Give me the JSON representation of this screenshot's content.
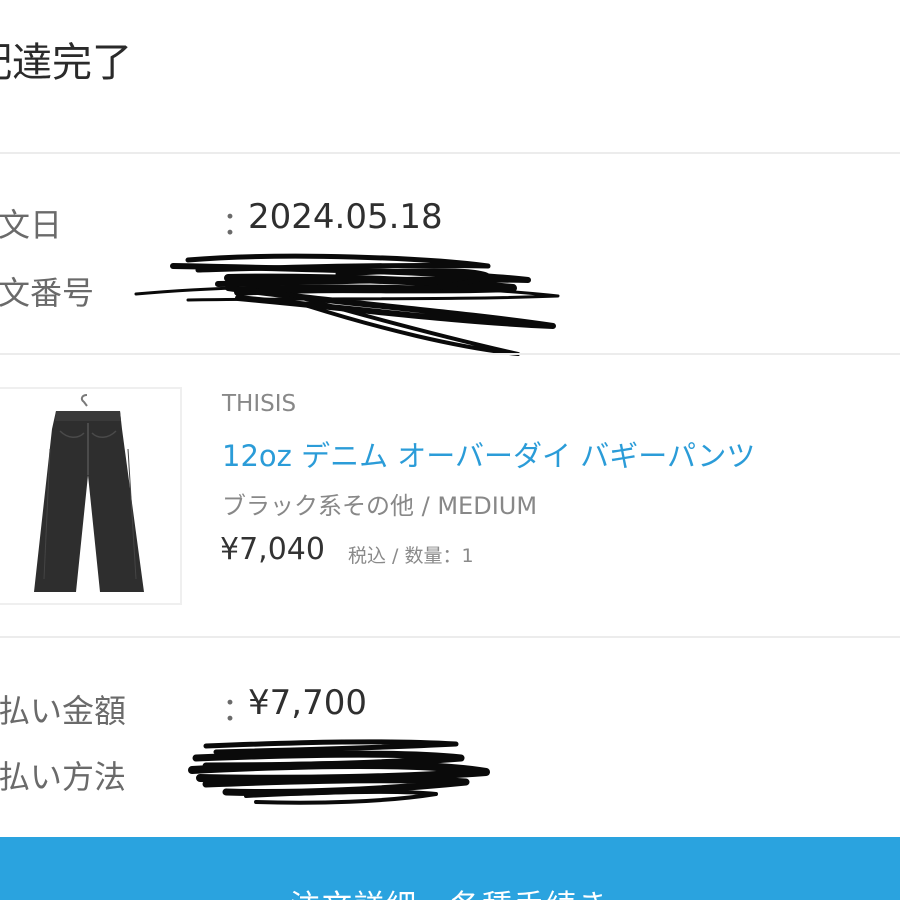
{
  "page": {
    "title": "配達完了"
  },
  "order": {
    "date_label": "注文日",
    "date_value": "2024.05.18",
    "number_label": "注文番号",
    "separator": "："
  },
  "item": {
    "brand": "THISIS",
    "name": "12oz デニム オーバーダイ バギーパンツ",
    "variant": "ブラック系その他 / MEDIUM",
    "price": "¥7,040",
    "price_note": "税込 / 数量：1"
  },
  "payment": {
    "amount_label": "支払い金額",
    "amount_value": "¥7,700",
    "method_label": "支払い方法"
  },
  "cta": {
    "label": "注文詳細・各種手続き"
  },
  "colors": {
    "accent": "#2aa3df",
    "link": "#2b9cd8"
  }
}
